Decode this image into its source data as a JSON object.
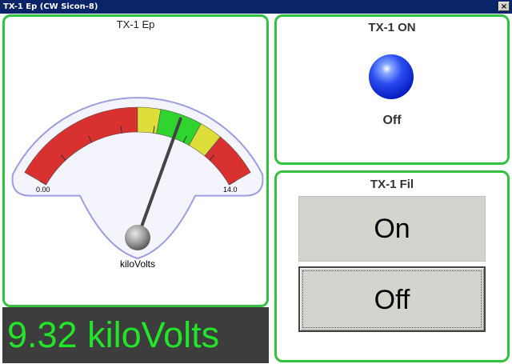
{
  "window": {
    "title": "TX-1 Ep (CW Sicon-8)",
    "close_glyph": "×"
  },
  "gauge": {
    "title": "TX-1 Ep",
    "min_label": "0.00",
    "max_label": "14.0",
    "unit_label": "kiloVolts",
    "min": 0,
    "max": 14,
    "value": 9.32,
    "zones": [
      {
        "from": 0,
        "to": 7.0,
        "color": "#d93030"
      },
      {
        "from": 7.0,
        "to": 8.2,
        "color": "#dede3a"
      },
      {
        "from": 8.2,
        "to": 10.4,
        "color": "#2fd42f"
      },
      {
        "from": 10.4,
        "to": 11.6,
        "color": "#dede3a"
      },
      {
        "from": 11.6,
        "to": 14,
        "color": "#d93030"
      }
    ],
    "colors": {
      "background": "#f4f4fc",
      "outline": "#9c9ce0",
      "needle": "#444444",
      "pivot": "#9a9a9a"
    }
  },
  "readout": {
    "text": "9.32 kiloVolts",
    "background": "#3d3d3d",
    "color": "#22e52a"
  },
  "tx_on": {
    "title": "TX-1 ON",
    "status": "Off",
    "lamp_color": "#1a33e0",
    "lamp_icon": "indicator-lamp-icon"
  },
  "tx_fil": {
    "title": "TX-1 Fil",
    "on_label": "On",
    "off_label": "Off"
  },
  "colors": {
    "panel_border": "#33c23f",
    "titlebar": "#0a246a"
  }
}
